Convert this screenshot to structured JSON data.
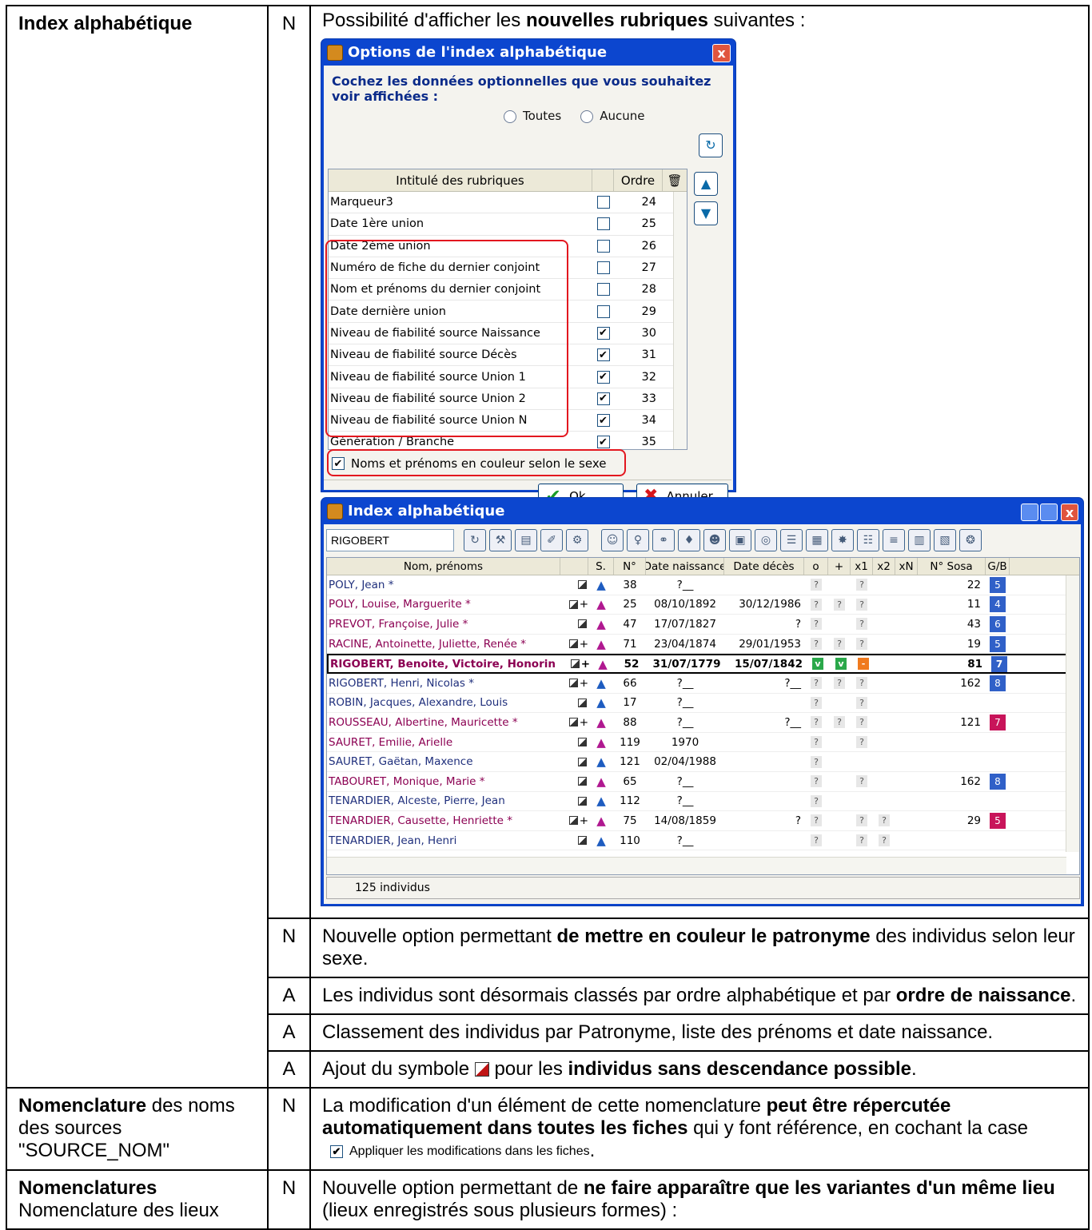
{
  "rows": {
    "index": {
      "title": "Index alphabétique",
      "code": "N",
      "intro_a": "Possibilité d'afficher les ",
      "intro_b": "nouvelles rubriques",
      "intro_c": " suivantes :"
    },
    "r2": {
      "code": "N",
      "t1": "Nouvelle option permettant ",
      "b1": "de mettre en couleur le patronyme",
      "t2": " des individus selon leur sexe."
    },
    "r3": {
      "code": "A",
      "t1": "Les individus sont désormais classés par ordre alphabétique et par ",
      "b1": "ordre de naissance",
      "t2": "."
    },
    "r4": {
      "code": "A",
      "t1": "Classement des individus par Patronyme, liste des prénoms et date naissance."
    },
    "r5": {
      "code": "A",
      "t1": "Ajout du symbole ",
      "t2": " pour les ",
      "b1": "individus sans descendance possible",
      "t3": "."
    },
    "r6": {
      "left_b": "Nomenclature",
      "left_t": " des noms des sources \"SOURCE_NOM\"",
      "code": "N",
      "t1": "La modification d'un élément de cette nomenclature ",
      "b1": "peut être répercutée automatiquement dans toutes les fiches",
      "t2": " qui y font référence, en cochant la case ",
      "check_label": "Appliquer les modifications dans les fiches",
      "t3": "."
    },
    "r7": {
      "left_b": "Nomenclatures",
      "left_t": "Nomenclature des lieux",
      "code": "N",
      "t1": "Nouvelle option permettant de ",
      "b1": "ne faire apparaître que les variantes d'un même lieu",
      "t2": " (lieux enregistrés sous plusieurs formes) :"
    }
  },
  "options_dialog": {
    "title": "Options de l'index alphabétique",
    "close": "x",
    "header": "Cochez les données optionnelles que vous souhaitez voir affichées :",
    "radio_all": "Toutes",
    "radio_none": "Aucune",
    "col_label": "Intitulé des rubriques",
    "col_order": "Ordre",
    "items": [
      {
        "label": "Marqueur3",
        "checked": false,
        "order": "24"
      },
      {
        "label": "Date 1ère union",
        "checked": false,
        "order": "25"
      },
      {
        "label": "Date 2ème union",
        "checked": false,
        "order": "26"
      },
      {
        "label": "Numéro de fiche du dernier conjoint",
        "checked": false,
        "order": "27"
      },
      {
        "label": "Nom et prénoms du dernier conjoint",
        "checked": false,
        "order": "28"
      },
      {
        "label": "Date dernière union",
        "checked": false,
        "order": "29"
      },
      {
        "label": "Niveau de fiabilité source Naissance",
        "checked": true,
        "order": "30"
      },
      {
        "label": "Niveau de fiabilité source Décès",
        "checked": true,
        "order": "31"
      },
      {
        "label": "Niveau de fiabilité source Union 1",
        "checked": true,
        "order": "32"
      },
      {
        "label": "Niveau de fiabilité source Union 2",
        "checked": true,
        "order": "33"
      },
      {
        "label": "Niveau de fiabilité source Union N",
        "checked": true,
        "order": "34"
      },
      {
        "label": "Génération / Branche",
        "checked": true,
        "order": "35"
      }
    ],
    "color_option": "Noms et prénoms en couleur selon le sexe",
    "ok": "Ok",
    "cancel": "Annuler"
  },
  "index_window": {
    "title": "Index alphabétique",
    "search_value": "RIGOBERT",
    "columns": [
      "Nom, prénoms",
      "",
      "S.",
      "N°",
      "Date naissance",
      "Date décès",
      "o",
      "+",
      "x1",
      "x2",
      "xN",
      "N° Sosa",
      "G/B"
    ],
    "status": "125  individus",
    "rows": [
      {
        "name": "POLY, Jean  *",
        "sex": "m",
        "plus": "",
        "num": "38",
        "birth": "?__",
        "death": "",
        "o": "?",
        "p": "",
        "x1": "?",
        "x2": "",
        "sosa": "22",
        "gb": "5",
        "gbc": "#3060c8",
        "sel": false
      },
      {
        "name": "POLY, Louise, Marguerite  *",
        "sex": "f",
        "plus": "+",
        "num": "25",
        "birth": "08/10/1892",
        "death": "30/12/1986",
        "o": "?",
        "p": "?",
        "x1": "?",
        "x2": "",
        "sosa": "11",
        "gb": "4",
        "gbc": "#3060c8",
        "sel": false
      },
      {
        "name": "PREVOT, Françoise, Julie  *",
        "sex": "f",
        "plus": "",
        "num": "47",
        "birth": "17/07/1827",
        "death": "?",
        "o": "?",
        "p": "",
        "x1": "?",
        "x2": "",
        "sosa": "43",
        "gb": "6",
        "gbc": "#3060c8",
        "sel": false
      },
      {
        "name": "RACINE, Antoinette, Juliette, Renée  *",
        "sex": "f",
        "plus": "+",
        "num": "71",
        "birth": "23/04/1874",
        "death": "29/01/1953",
        "o": "?",
        "p": "?",
        "x1": "?",
        "x2": "",
        "sosa": "19",
        "gb": "5",
        "gbc": "#3060c8",
        "sel": false
      },
      {
        "name": "RIGOBERT, Benoite, Victoire, Honorin",
        "sex": "f",
        "plus": "+",
        "num": "52",
        "birth": "31/07/1779",
        "death": "15/07/1842",
        "o": "v",
        "p": "v",
        "x1": "-",
        "x2": "",
        "sosa": "81",
        "gb": "7",
        "gbc": "#3060c8",
        "sel": true
      },
      {
        "name": "RIGOBERT, Henri, Nicolas  *",
        "sex": "m",
        "plus": "+",
        "num": "66",
        "birth": "?__",
        "death": "?__",
        "o": "?",
        "p": "?",
        "x1": "?",
        "x2": "",
        "sosa": "162",
        "gb": "8",
        "gbc": "#3060c8",
        "sel": false
      },
      {
        "name": "ROBIN, Jacques, Alexandre, Louis",
        "sex": "m",
        "plus": "",
        "num": "17",
        "birth": "?__",
        "death": "",
        "o": "?",
        "p": "",
        "x1": "?",
        "x2": "",
        "sosa": "",
        "gb": "",
        "gbc": "",
        "sel": false
      },
      {
        "name": "ROUSSEAU, Albertine, Mauricette  *",
        "sex": "f",
        "plus": "+",
        "num": "88",
        "birth": "?__",
        "death": "?__",
        "o": "?",
        "p": "?",
        "x1": "?",
        "x2": "",
        "sosa": "121",
        "gb": "7",
        "gbc": "#c8145a",
        "sel": false
      },
      {
        "name": "SAURET, Emilie, Arielle",
        "sex": "f",
        "plus": "",
        "num": "119",
        "birth": "1970",
        "death": "",
        "o": "?",
        "p": "",
        "x1": "?",
        "x2": "",
        "sosa": "",
        "gb": "",
        "gbc": "",
        "sel": false
      },
      {
        "name": "SAURET, Gaëtan, Maxence",
        "sex": "m",
        "plus": "",
        "num": "121",
        "birth": "02/04/1988",
        "death": "",
        "o": "?",
        "p": "",
        "x1": "",
        "x2": "",
        "sosa": "",
        "gb": "",
        "gbc": "",
        "sel": false
      },
      {
        "name": "TABOURET, Monique, Marie  *",
        "sex": "f",
        "plus": "",
        "num": "65",
        "birth": "?__",
        "death": "",
        "o": "?",
        "p": "",
        "x1": "?",
        "x2": "",
        "sosa": "162",
        "gb": "8",
        "gbc": "#3060c8",
        "sel": false
      },
      {
        "name": "TENARDIER, Alceste, Pierre, Jean",
        "sex": "m",
        "plus": "",
        "num": "112",
        "birth": "?__",
        "death": "",
        "o": "?",
        "p": "",
        "x1": "",
        "x2": "",
        "sosa": "",
        "gb": "",
        "gbc": "",
        "sel": false
      },
      {
        "name": "TENARDIER, Causette, Henriette  *",
        "sex": "f",
        "plus": "+",
        "num": "75",
        "birth": "14/08/1859",
        "death": "?",
        "o": "?",
        "p": "",
        "x1": "?",
        "x2": "?",
        "sosa": "29",
        "gb": "5",
        "gbc": "#c8145a",
        "sel": false
      },
      {
        "name": "TENARDIER, Jean, Henri",
        "sex": "m",
        "plus": "",
        "num": "110",
        "birth": "?__",
        "death": "",
        "o": "?",
        "p": "",
        "x1": "?",
        "x2": "?",
        "sosa": "",
        "gb": "",
        "gbc": "",
        "sel": false
      }
    ]
  }
}
